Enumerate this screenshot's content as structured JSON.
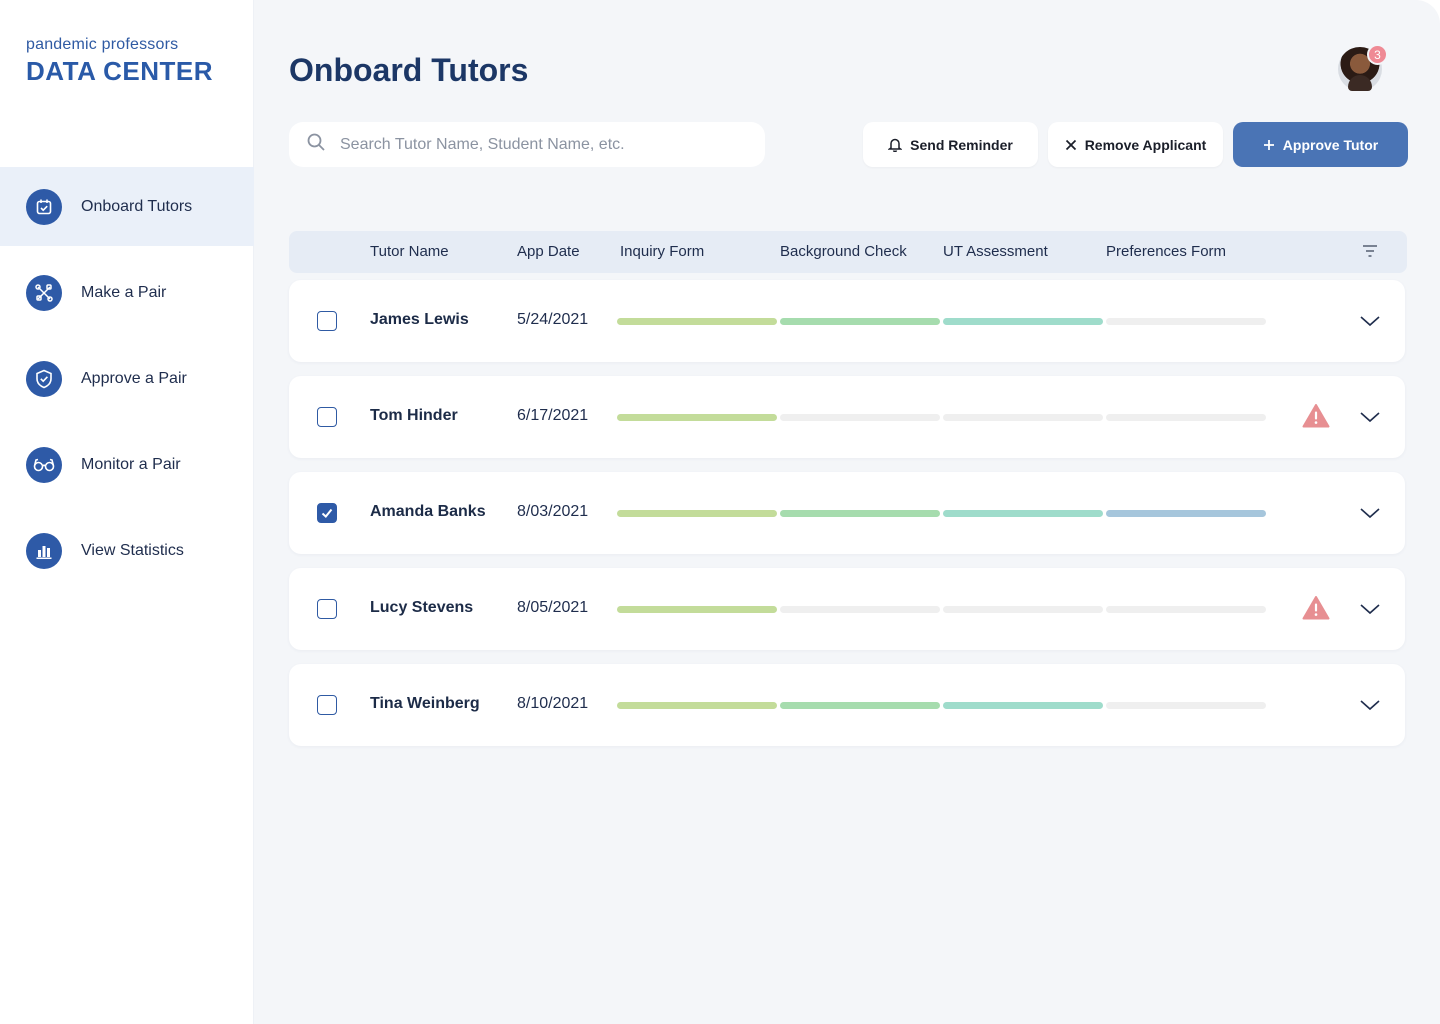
{
  "brand": {
    "subtitle": "pandemic professors",
    "title": "DATA CENTER"
  },
  "nav": [
    {
      "label": "Onboard Tutors",
      "icon": "calendar-check-icon",
      "active": true
    },
    {
      "label": "Make a Pair",
      "icon": "tools-icon",
      "active": false
    },
    {
      "label": "Approve a Pair",
      "icon": "shield-check-icon",
      "active": false
    },
    {
      "label": "Monitor a Pair",
      "icon": "glasses-icon",
      "active": false
    },
    {
      "label": "View Statistics",
      "icon": "bar-chart-icon",
      "active": false
    }
  ],
  "page": {
    "title": "Onboard Tutors"
  },
  "user": {
    "notifications": "3"
  },
  "search": {
    "placeholder": "Search Tutor Name, Student Name, etc."
  },
  "actions": {
    "send_reminder": "Send Reminder",
    "remove_applicant": "Remove Applicant",
    "approve_tutor": "Approve Tutor"
  },
  "columns": [
    "Tutor Name",
    "App Date",
    "Inquiry Form",
    "Background Check",
    "UT Assessment",
    "Preferences Form"
  ],
  "colors": {
    "step1": "#c3dc9a",
    "step2": "#a6dcae",
    "step3": "#9fdccb",
    "step4": "#a6c6dc",
    "empty": "#efefef",
    "warning": "#e78f92",
    "accent": "#2e5aa7"
  },
  "rows": [
    {
      "name": "James Lewis",
      "date": "5/24/2021",
      "steps_complete": 3,
      "checked": false,
      "warning": false
    },
    {
      "name": "Tom Hinder",
      "date": "6/17/2021",
      "steps_complete": 1,
      "checked": false,
      "warning": true
    },
    {
      "name": "Amanda Banks",
      "date": "8/03/2021",
      "steps_complete": 4,
      "checked": true,
      "warning": false
    },
    {
      "name": "Lucy Stevens",
      "date": "8/05/2021",
      "steps_complete": 1,
      "checked": false,
      "warning": true
    },
    {
      "name": "Tina Weinberg",
      "date": "8/10/2021",
      "steps_complete": 3,
      "checked": false,
      "warning": false
    }
  ]
}
